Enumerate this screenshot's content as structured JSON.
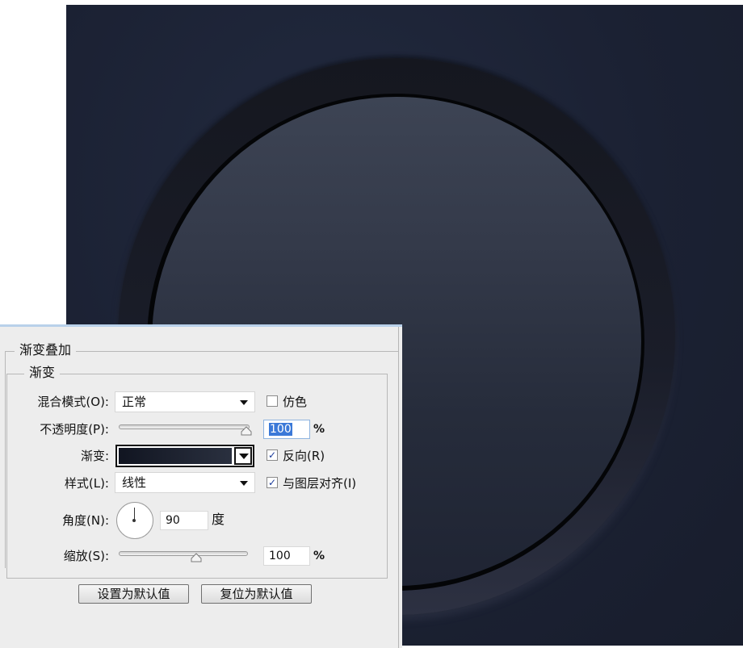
{
  "dialog": {
    "section_title": "渐变叠加",
    "group_title": "渐变",
    "blend_mode": {
      "label": "混合模式(O):",
      "value": "正常"
    },
    "dither": {
      "label": "仿色",
      "checked": false
    },
    "opacity": {
      "label": "不透明度(P):",
      "value": "100",
      "unit": "%",
      "level": 100
    },
    "gradient": {
      "label": "渐变:",
      "color_start": "#111521",
      "color_end": "#2a303f"
    },
    "reverse": {
      "label": "反向(R)",
      "checked": true
    },
    "style": {
      "label": "样式(L):",
      "value": "线性"
    },
    "align_with_layer": {
      "label": "与图层对齐(I)",
      "checked": true
    },
    "angle": {
      "label": "角度(N):",
      "value": "90",
      "unit": "度"
    },
    "scale": {
      "label": "缩放(S):",
      "value": "100",
      "unit": "%",
      "level_fraction": 0.6
    },
    "buttons": {
      "make_default": "设置为默认值",
      "reset_default": "复位为默认值"
    }
  },
  "canvas": {
    "background_color": "#1b2133",
    "icons": {
      "dropdown": "chevron-down-icon",
      "checkbox": "check-icon"
    }
  }
}
